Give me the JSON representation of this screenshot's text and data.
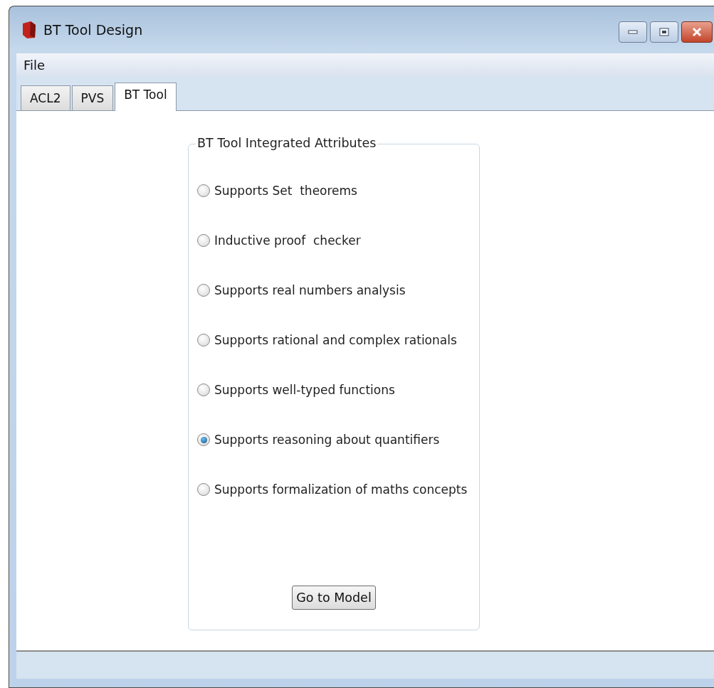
{
  "window": {
    "title": "BT Tool Design"
  },
  "menu": [
    "File"
  ],
  "tabs": [
    {
      "label": "ACL2",
      "selected": false
    },
    {
      "label": "PVS",
      "selected": false
    },
    {
      "label": "BT Tool",
      "selected": true
    }
  ],
  "group": {
    "title": "BT Tool Integrated Attributes",
    "options": [
      {
        "label": "Supports Set  theorems",
        "selected": false
      },
      {
        "label": "Inductive proof  checker",
        "selected": false
      },
      {
        "label": "Supports real numbers analysis",
        "selected": false
      },
      {
        "label": "Supports rational and complex rationals",
        "selected": false
      },
      {
        "label": "Supports well-typed functions",
        "selected": false
      },
      {
        "label": "Supports reasoning about quantifiers",
        "selected": true
      },
      {
        "label": "Supports formalization of maths concepts",
        "selected": false
      }
    ],
    "button": "Go to Model"
  }
}
